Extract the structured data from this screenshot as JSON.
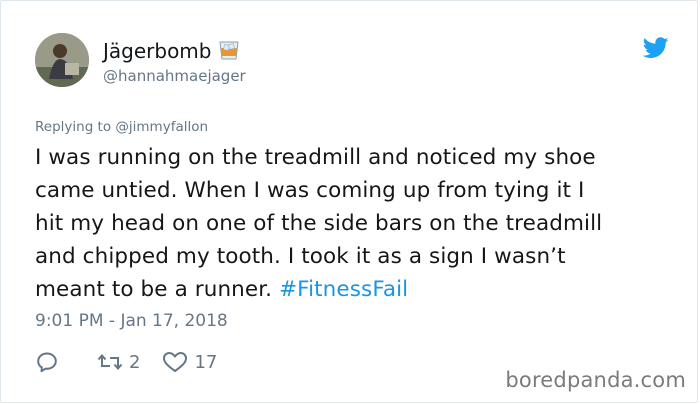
{
  "tweet": {
    "display_name": "Jägerbomb",
    "name_emoji_icon": "tumbler-glass-icon",
    "handle": "@hannahmaejager",
    "reply_prefix": "Replying to",
    "reply_to": "@jimmyfallon",
    "text_lines": [
      "I was running on the treadmill and noticed my shoe",
      "came untied. When I was coming up from tying it I",
      "hit my head on one of the side bars on the treadmill",
      "and chipped my tooth. I took it as a sign I wasn’t",
      "meant to be a runner."
    ],
    "hashtag": "#FitnessFail",
    "timestamp": "9:01 PM - Jan 17, 2018",
    "reply_icon": "reply-icon",
    "retweet_icon": "retweet-icon",
    "retweet_count": "2",
    "like_icon": "heart-icon",
    "like_count": "17"
  },
  "brand": {
    "icon": "twitter-bird-icon",
    "color": "#1da1f2"
  },
  "watermark": {
    "text": "boredpanda.com"
  },
  "colors": {
    "text": "#14171a",
    "secondary": "#657786",
    "link": "#1b95e0"
  }
}
